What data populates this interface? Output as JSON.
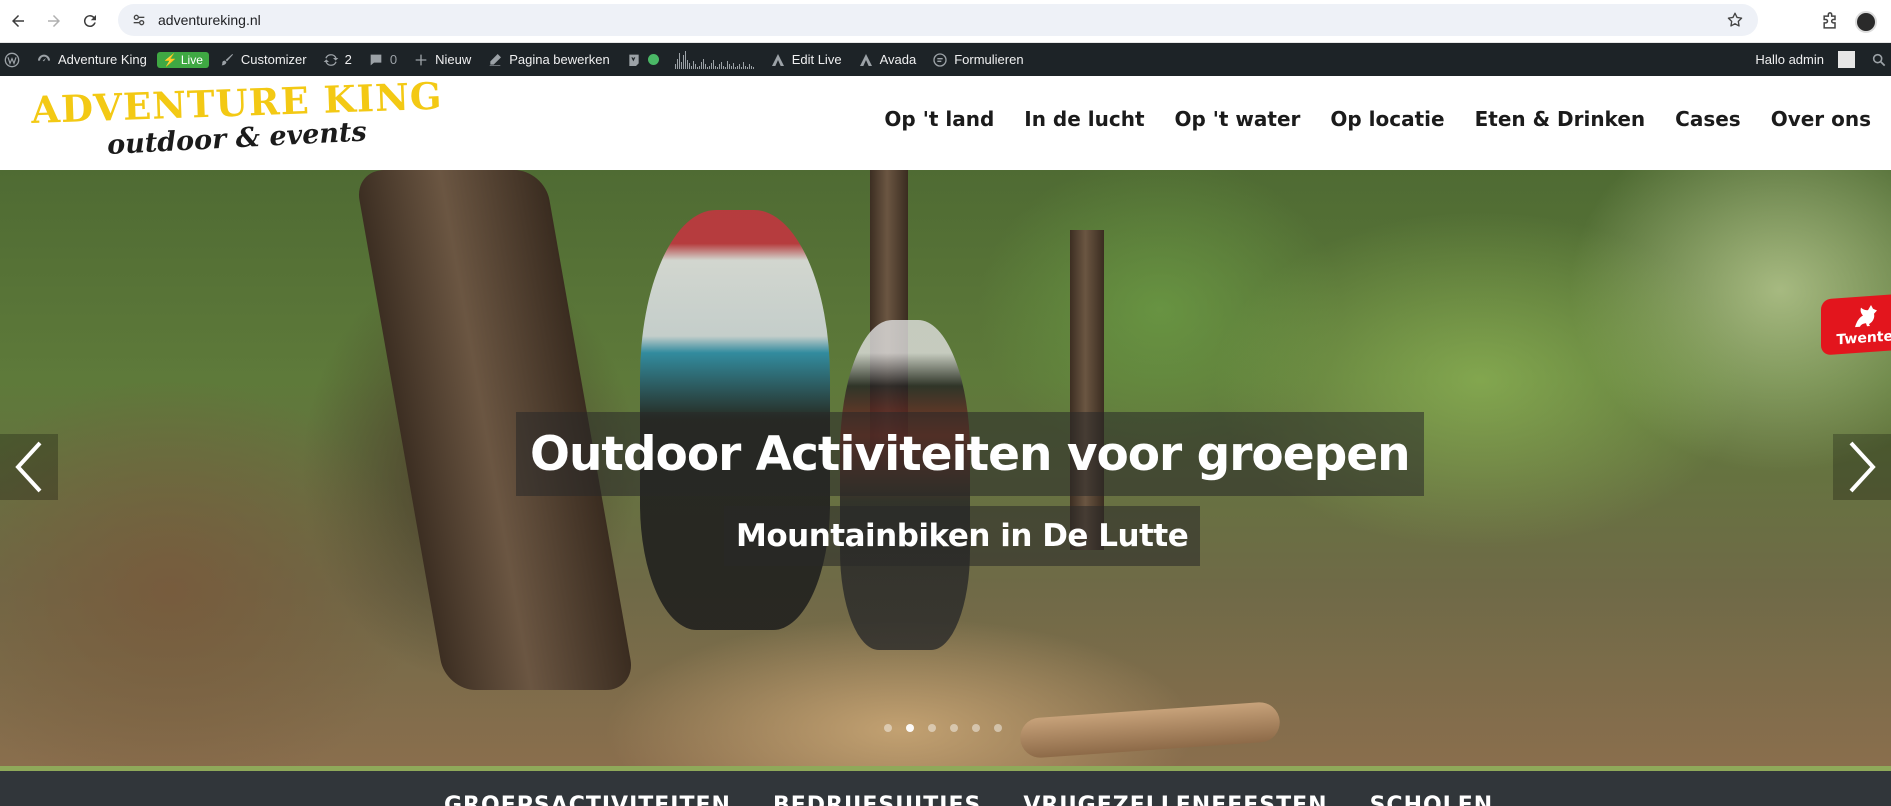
{
  "browser": {
    "url": "adventureking.nl",
    "icons": [
      "back-icon",
      "forward-icon",
      "reload-icon",
      "site-settings-icon",
      "bookmark-star-icon",
      "extensions-icon",
      "profile-avatar"
    ]
  },
  "admin_bar": {
    "site_name": "Adventure King",
    "live_badge": "Live",
    "customizer": "Customizer",
    "updates_count": "2",
    "comments_count": "0",
    "new_label": "Nieuw",
    "edit_page": "Pagina bewerken",
    "edit_live": "Edit Live",
    "avada": "Avada",
    "forms": "Formulieren",
    "greeting": "Hallo admin",
    "status_color": "#4ab866",
    "spark_values": [
      4,
      9,
      14,
      6,
      12,
      16,
      8,
      5,
      3,
      7,
      4,
      2,
      3,
      6,
      9,
      4,
      2,
      3,
      5,
      8,
      3,
      2,
      4,
      6,
      3,
      2,
      7,
      4,
      3,
      5,
      2,
      3,
      4,
      2,
      6,
      3,
      2,
      4,
      3,
      2
    ]
  },
  "header": {
    "logo_top": "ADVENTURE KING",
    "logo_bottom": "outdoor & events",
    "logo_color": "#f3c914",
    "nav": [
      "Op 't land",
      "In de lucht",
      "Op 't water",
      "Op locatie",
      "Eten & Drinken",
      "Cases",
      "Over ons"
    ]
  },
  "hero": {
    "heading": "Outdoor Activiteiten voor groepen",
    "caption": "Mountainbiken in De Lutte",
    "dots_total": 6,
    "active_dot": 2,
    "badge_text": "Twente"
  },
  "category_bar": {
    "items": [
      "GROEPSACTIVITEITEN",
      "BEDRIJFSUITJES",
      "VRIJGEZELLENFEESTEN",
      "SCHOLEN"
    ],
    "accent_color": "#8fa95a"
  }
}
